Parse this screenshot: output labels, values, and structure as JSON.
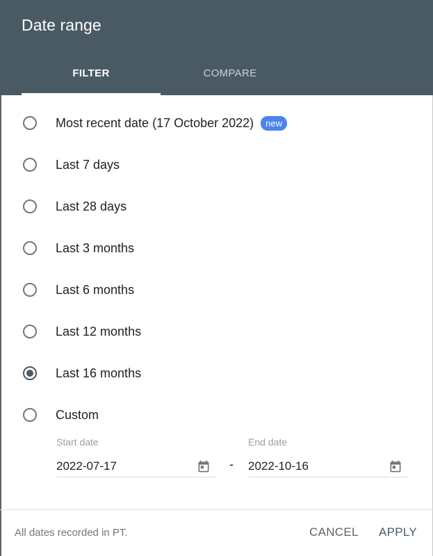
{
  "dialog": {
    "title": "Date range",
    "tabs": [
      {
        "label": "FILTER",
        "active": true
      },
      {
        "label": "COMPARE",
        "active": false
      }
    ],
    "options": [
      {
        "label": "Most recent date (17 October 2022)",
        "badge": "new",
        "checked": false
      },
      {
        "label": "Last 7 days",
        "checked": false
      },
      {
        "label": "Last 28 days",
        "checked": false
      },
      {
        "label": "Last 3 months",
        "checked": false
      },
      {
        "label": "Last 6 months",
        "checked": false
      },
      {
        "label": "Last 12 months",
        "checked": false
      },
      {
        "label": "Last 16 months",
        "checked": true
      },
      {
        "label": "Custom",
        "checked": false
      }
    ],
    "custom": {
      "start_label": "Start date",
      "start_value": "2022-07-17",
      "separator": "-",
      "end_label": "End date",
      "end_value": "2022-10-16"
    },
    "footer": {
      "note": "All dates recorded in PT.",
      "cancel_label": "CANCEL",
      "apply_label": "APPLY"
    }
  },
  "colors": {
    "header": "#4a5a64",
    "badge": "#4c84ef",
    "selected_radio": "#4a5a64"
  }
}
